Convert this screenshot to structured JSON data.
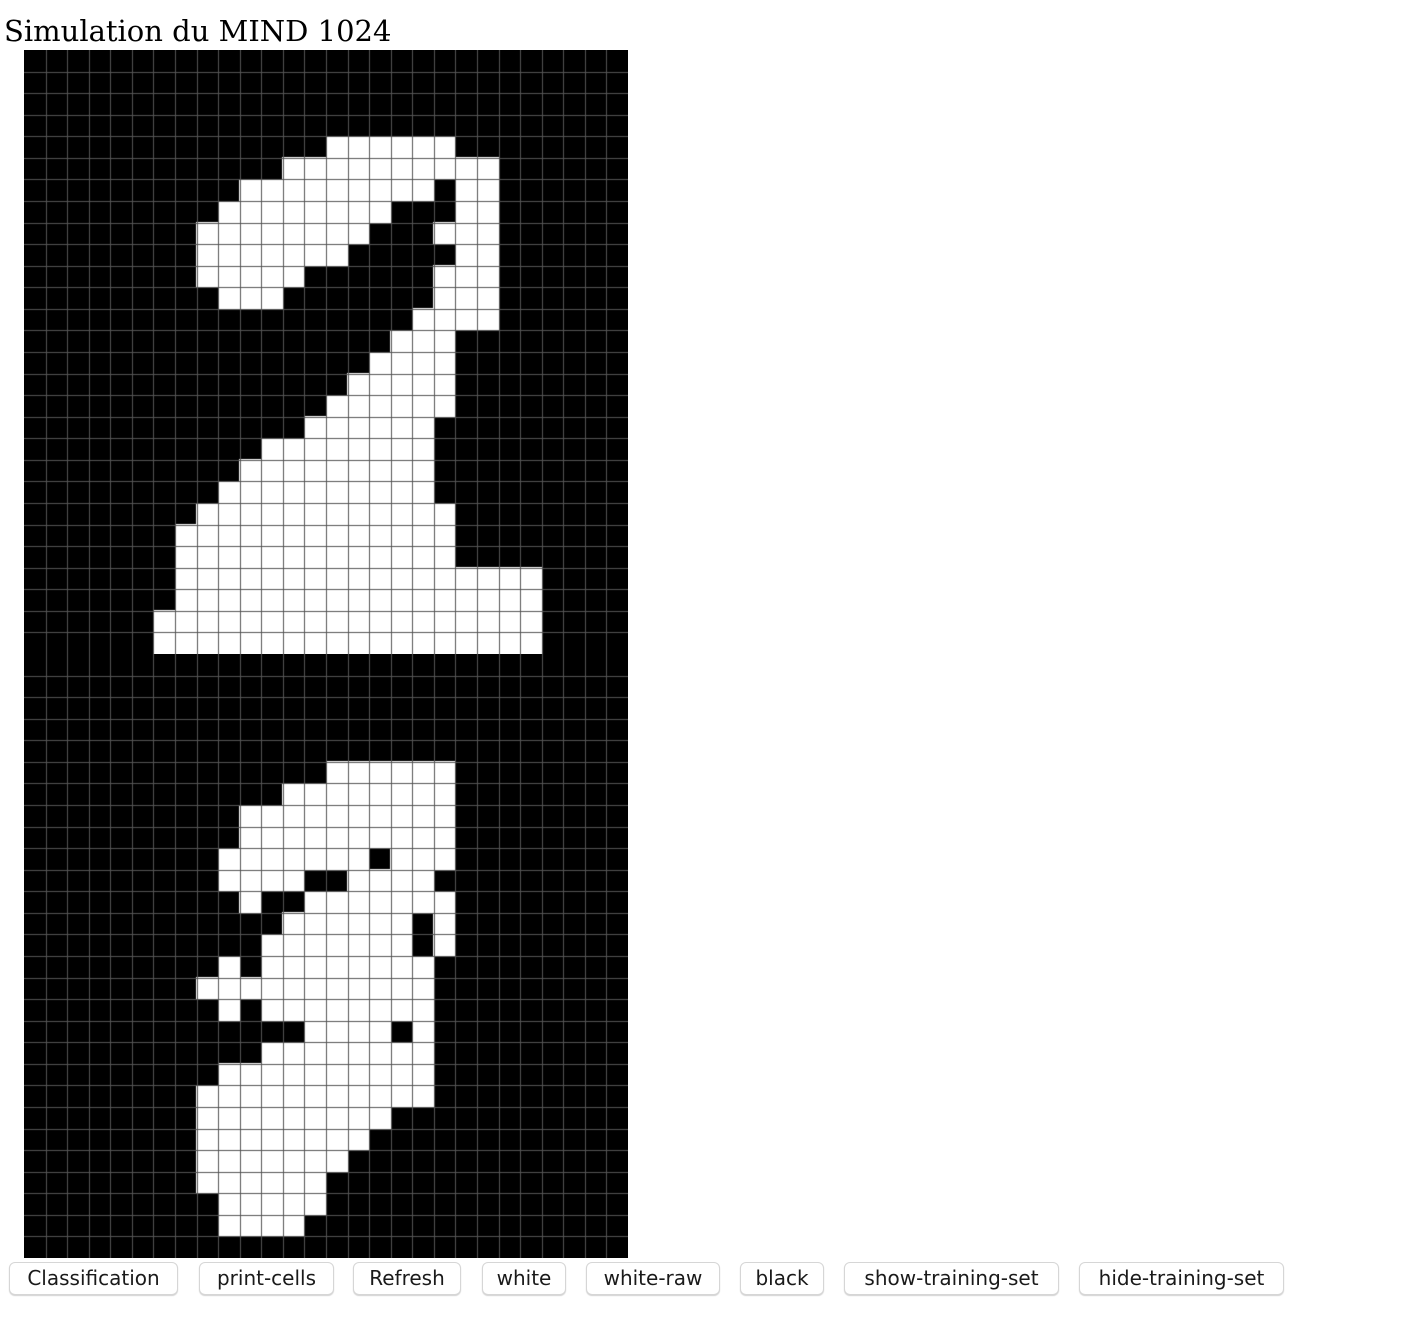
{
  "page": {
    "title": "Simulation du MIND 1024"
  },
  "grid": {
    "columns": 28,
    "rows": 28,
    "on_color": "#ffffff",
    "off_color": "#000000",
    "grid_line_color": "#555555",
    "panels": [
      {
        "digit_shown": "2",
        "cells": [
          "0000000000000000000000000000",
          "0000000000000000000000000000",
          "0000000000000000000000000000",
          "0000000000000000000000000000",
          "0000000000000011111100000000",
          "0000000000001111111111000000",
          "0000000000111111111011000000",
          "0000000001111111100011000000",
          "0000000011111111000111000000",
          "0000000011111110000011000000",
          "0000000011111000000111000000",
          "0000000001110000000111000000",
          "0000000000000000001111000000",
          "0000000000000000011100000000",
          "0000000000000000111100000000",
          "0000000000000001111100000000",
          "0000000000000011111100000000",
          "0000000000000111111000000000",
          "0000000000011111111000000000",
          "0000000000111111111000000000",
          "0000000001111111111000000000",
          "0000000011111111111100000000",
          "0000000111111111111100000000",
          "0000000111111111111100000000",
          "0000000111111111111111110000",
          "0000000111111111111111110000",
          "0000001111111111111111110000",
          "0000001111111111111111110000"
        ]
      },
      {
        "digit_shown": "3",
        "cells": [
          "0000000000000000000000000000",
          "0000000000000000000000000000",
          "0000000000000000000000000000",
          "0000000000000000000000000000",
          "0000000000000000000000000000",
          "0000000000000011111100000000",
          "0000000000001111111100000000",
          "0000000000111111111100000000",
          "0000000000111111111100000000",
          "0000000001111111011100000000",
          "0000000001111001111000000000",
          "0000000000100111111100000000",
          "0000000000001111110100000000",
          "0000000000011111110100000000",
          "0000000001011111111000000000",
          "0000000011111111111000000000",
          "0000000001011111111000000000",
          "0000000000000111101000000000",
          "0000000000011111111000000000",
          "0000000001111111111000000000",
          "0000000011111111111000000000",
          "0000000011111111100000000000",
          "0000000011111111000000000000",
          "0000000011111110000000000000",
          "0000000011111100000000000000",
          "0000000001111100000000000000",
          "0000000001111000000000000000",
          "0000000000000000000000000000"
        ]
      }
    ]
  },
  "toolbar": {
    "buttons": [
      {
        "id": "classification",
        "label": "Classification"
      },
      {
        "id": "print-cells",
        "label": "print-cells"
      },
      {
        "id": "refresh",
        "label": "Refresh"
      },
      {
        "id": "white",
        "label": "white"
      },
      {
        "id": "white-raw",
        "label": "white-raw"
      },
      {
        "id": "black",
        "label": "black"
      },
      {
        "id": "show-training-set",
        "label": "show-training-set"
      },
      {
        "id": "hide-training-set",
        "label": "hide-training-set"
      }
    ]
  }
}
